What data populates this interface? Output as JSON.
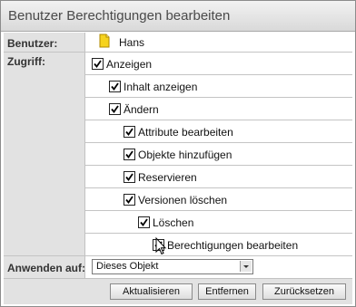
{
  "dialog": {
    "title": "Benutzer Berechtigungen bearbeiten",
    "user_label": "Benutzer:",
    "user_name": "Hans",
    "user_icon": "user-icon",
    "access_label": "Zugriff:",
    "apply_label": "Anwenden auf:",
    "apply_value": "Dieses Objekt"
  },
  "permissions": [
    {
      "label": "Anzeigen",
      "checked": true
    },
    {
      "label": "Inhalt anzeigen",
      "checked": true
    },
    {
      "label": "Ändern",
      "checked": true
    },
    {
      "label": "Attribute bearbeiten",
      "checked": true
    },
    {
      "label": "Objekte hinzufügen",
      "checked": true
    },
    {
      "label": "Reservieren",
      "checked": true
    },
    {
      "label": "Versionen löschen",
      "checked": true
    },
    {
      "label": "Löschen",
      "checked": true
    },
    {
      "label": "Berechtigungen bearbeiten",
      "checked": true
    }
  ],
  "buttons": {
    "update": "Aktualisieren",
    "remove": "Entfernen",
    "reset": "Zurücksetzen"
  }
}
